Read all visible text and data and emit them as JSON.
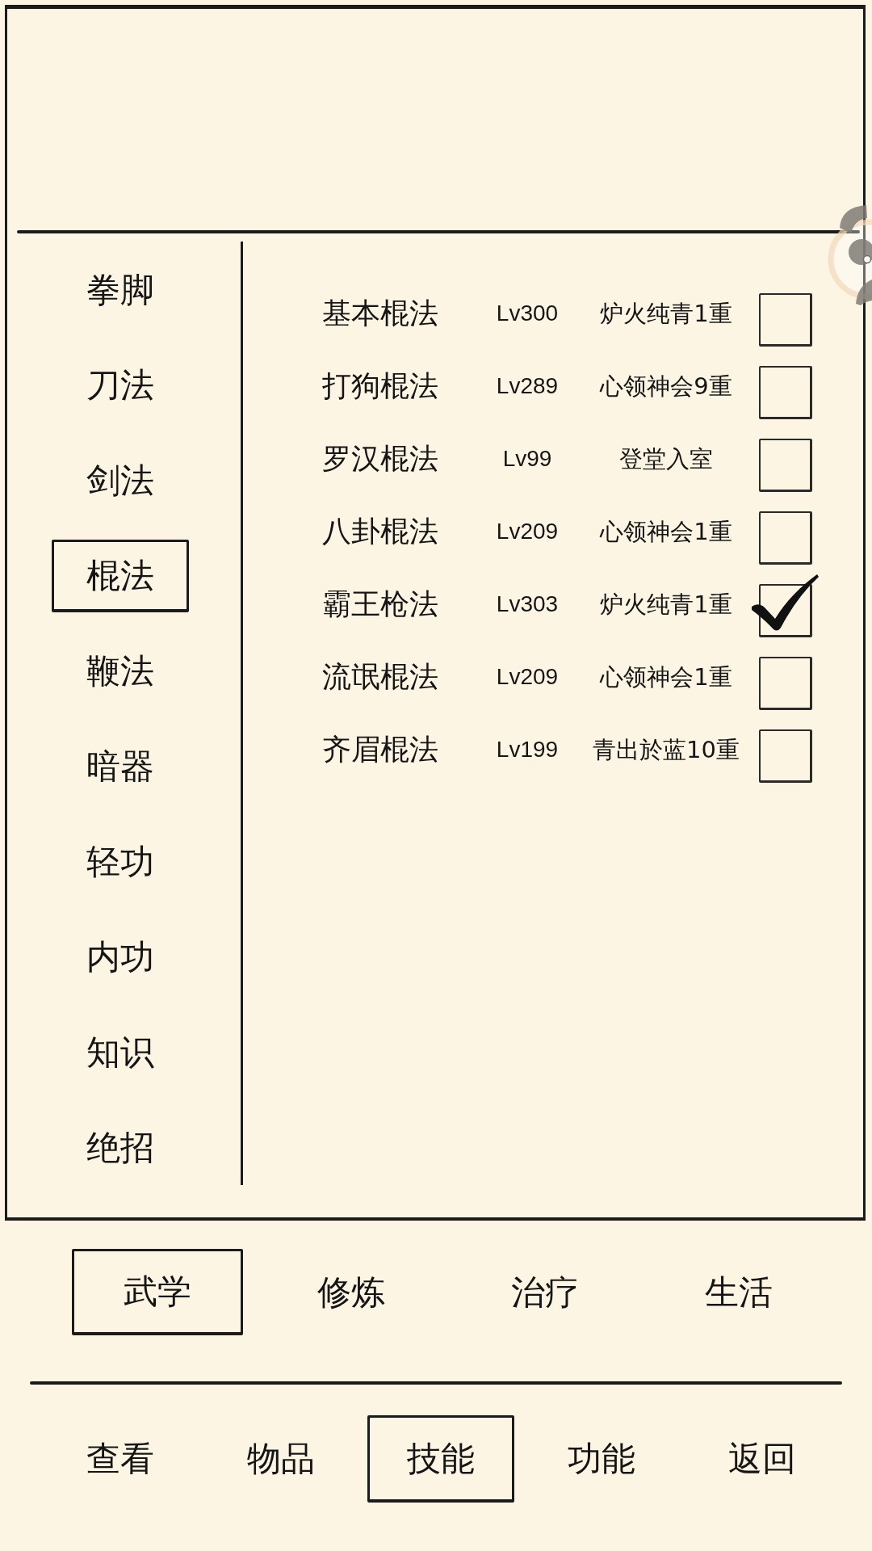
{
  "categories": [
    {
      "label": "拳脚",
      "selected": false
    },
    {
      "label": "刀法",
      "selected": false
    },
    {
      "label": "剑法",
      "selected": false
    },
    {
      "label": "棍法",
      "selected": true
    },
    {
      "label": "鞭法",
      "selected": false
    },
    {
      "label": "暗器",
      "selected": false
    },
    {
      "label": "轻功",
      "selected": false
    },
    {
      "label": "内功",
      "selected": false
    },
    {
      "label": "知识",
      "selected": false
    },
    {
      "label": "绝招",
      "selected": false
    }
  ],
  "skills": [
    {
      "name": "基本棍法",
      "rank": "Lv300",
      "stage": "炉火纯青1重",
      "checked": false
    },
    {
      "name": "打狗棍法",
      "rank": "Lv289",
      "stage": "心领神会9重",
      "checked": false
    },
    {
      "name": "罗汉棍法",
      "rank": "Lv99",
      "stage": "登堂入室",
      "checked": false
    },
    {
      "name": "八卦棍法",
      "rank": "Lv209",
      "stage": "心领神会1重",
      "checked": false
    },
    {
      "name": "霸王枪法",
      "rank": "Lv303",
      "stage": "炉火纯青1重",
      "checked": true
    },
    {
      "name": "流氓棍法",
      "rank": "Lv209",
      "stage": "心领神会1重",
      "checked": false
    },
    {
      "name": "齐眉棍法",
      "rank": "Lv199",
      "stage": "青出於蓝10重",
      "checked": false
    }
  ],
  "subtabs": [
    {
      "label": "武学",
      "selected": true
    },
    {
      "label": "修炼",
      "selected": false
    },
    {
      "label": "治疗",
      "selected": false
    },
    {
      "label": "生活",
      "selected": false
    }
  ],
  "nav": [
    {
      "label": "查看",
      "selected": false
    },
    {
      "label": "物品",
      "selected": false
    },
    {
      "label": "技能",
      "selected": true
    },
    {
      "label": "功能",
      "selected": false
    },
    {
      "label": "返回",
      "selected": false
    }
  ]
}
